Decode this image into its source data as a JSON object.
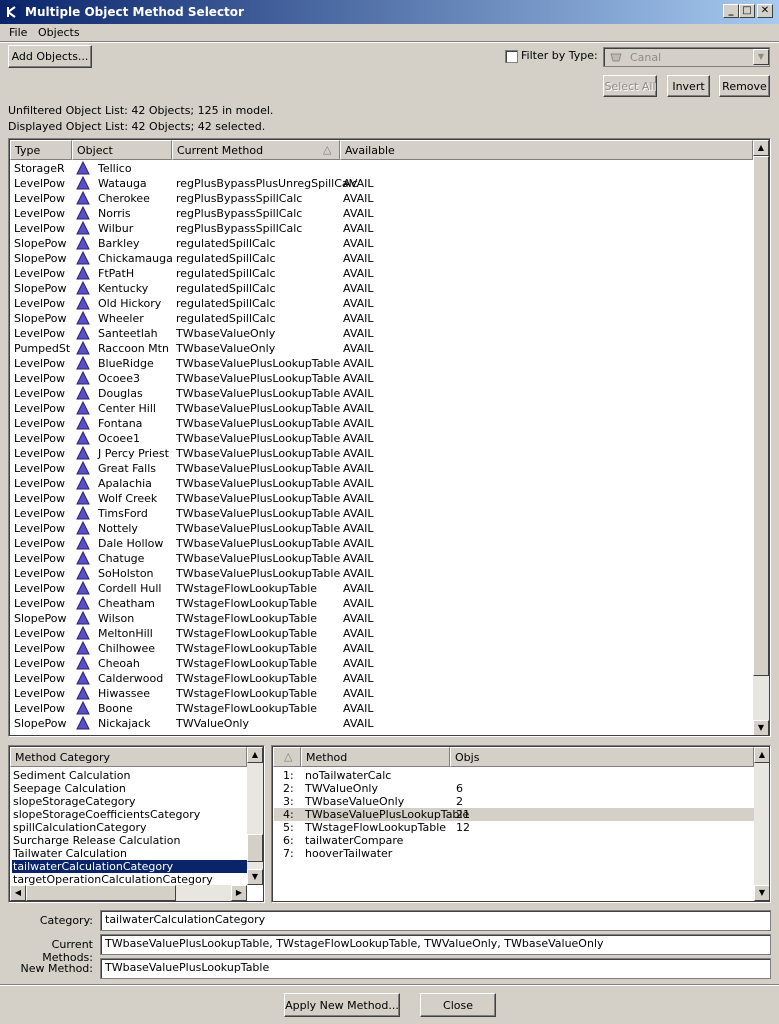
{
  "window": {
    "title": "Multiple Object Method Selector",
    "controls": {
      "minimize": "_",
      "maximize": "□",
      "close": "✕"
    }
  },
  "menu": [
    "File",
    "Objects"
  ],
  "toolbar": {
    "add_objects": "Add Objects...",
    "filter_label": "Filter by Type:",
    "filter_checked": false,
    "filter_value": "Canal",
    "filter_icon": "canal-icon",
    "select_all": "Select All",
    "invert": "Invert",
    "remove": "Remove"
  },
  "summary": {
    "unfiltered": "Unfiltered Object List:  42 Objects;  125 in model.",
    "displayed": "Displayed Object List:  42 Objects;  42 selected."
  },
  "object_table": {
    "columns": [
      "Type",
      "Object",
      "Current Method",
      "Available"
    ],
    "sort_indicator": "△",
    "rows": [
      {
        "type": "StorageR",
        "object": "Tellico",
        "method": "",
        "available": ""
      },
      {
        "type": "LevelPow",
        "object": "Watauga",
        "method": "regPlusBypassPlusUnregSpillCalc",
        "available": "AVAIL"
      },
      {
        "type": "LevelPow",
        "object": "Cherokee",
        "method": "regPlusBypassSpillCalc",
        "available": "AVAIL"
      },
      {
        "type": "LevelPow",
        "object": "Norris",
        "method": "regPlusBypassSpillCalc",
        "available": "AVAIL"
      },
      {
        "type": "LevelPow",
        "object": "Wilbur",
        "method": "regPlusBypassSpillCalc",
        "available": "AVAIL"
      },
      {
        "type": "SlopePow",
        "object": "Barkley",
        "method": "regulatedSpillCalc",
        "available": "AVAIL"
      },
      {
        "type": "SlopePow",
        "object": "Chickamauga",
        "method": "regulatedSpillCalc",
        "available": "AVAIL"
      },
      {
        "type": "LevelPow",
        "object": "FtPatH",
        "method": "regulatedSpillCalc",
        "available": "AVAIL"
      },
      {
        "type": "SlopePow",
        "object": "Kentucky",
        "method": "regulatedSpillCalc",
        "available": "AVAIL"
      },
      {
        "type": "LevelPow",
        "object": "Old Hickory",
        "method": "regulatedSpillCalc",
        "available": "AVAIL"
      },
      {
        "type": "SlopePow",
        "object": "Wheeler",
        "method": "regulatedSpillCalc",
        "available": "AVAIL"
      },
      {
        "type": "LevelPow",
        "object": "Santeetlah",
        "method": "TWbaseValueOnly",
        "available": "AVAIL"
      },
      {
        "type": "PumpedSt",
        "object": "Raccoon Mtn",
        "method": "TWbaseValueOnly",
        "available": "AVAIL"
      },
      {
        "type": "LevelPow",
        "object": "BlueRidge",
        "method": "TWbaseValuePlusLookupTable",
        "available": "AVAIL"
      },
      {
        "type": "LevelPow",
        "object": "Ocoee3",
        "method": "TWbaseValuePlusLookupTable",
        "available": "AVAIL"
      },
      {
        "type": "LevelPow",
        "object": "Douglas",
        "method": "TWbaseValuePlusLookupTable",
        "available": "AVAIL"
      },
      {
        "type": "LevelPow",
        "object": "Center Hill",
        "method": "TWbaseValuePlusLookupTable",
        "available": "AVAIL"
      },
      {
        "type": "LevelPow",
        "object": "Fontana",
        "method": "TWbaseValuePlusLookupTable",
        "available": "AVAIL"
      },
      {
        "type": "LevelPow",
        "object": "Ocoee1",
        "method": "TWbaseValuePlusLookupTable",
        "available": "AVAIL"
      },
      {
        "type": "LevelPow",
        "object": "J Percy Priest",
        "method": "TWbaseValuePlusLookupTable",
        "available": "AVAIL"
      },
      {
        "type": "LevelPow",
        "object": "Great Falls",
        "method": "TWbaseValuePlusLookupTable",
        "available": "AVAIL"
      },
      {
        "type": "LevelPow",
        "object": "Apalachia",
        "method": "TWbaseValuePlusLookupTable",
        "available": "AVAIL"
      },
      {
        "type": "LevelPow",
        "object": "Wolf Creek",
        "method": "TWbaseValuePlusLookupTable",
        "available": "AVAIL"
      },
      {
        "type": "LevelPow",
        "object": "TimsFord",
        "method": "TWbaseValuePlusLookupTable",
        "available": "AVAIL"
      },
      {
        "type": "LevelPow",
        "object": "Nottely",
        "method": "TWbaseValuePlusLookupTable",
        "available": "AVAIL"
      },
      {
        "type": "LevelPow",
        "object": "Dale Hollow",
        "method": "TWbaseValuePlusLookupTable",
        "available": "AVAIL"
      },
      {
        "type": "LevelPow",
        "object": "Chatuge",
        "method": "TWbaseValuePlusLookupTable",
        "available": "AVAIL"
      },
      {
        "type": "LevelPow",
        "object": "SoHolston",
        "method": "TWbaseValuePlusLookupTable",
        "available": "AVAIL"
      },
      {
        "type": "LevelPow",
        "object": "Cordell Hull",
        "method": "TWstageFlowLookupTable",
        "available": "AVAIL"
      },
      {
        "type": "LevelPow",
        "object": "Cheatham",
        "method": "TWstageFlowLookupTable",
        "available": "AVAIL"
      },
      {
        "type": "SlopePow",
        "object": "Wilson",
        "method": "TWstageFlowLookupTable",
        "available": "AVAIL"
      },
      {
        "type": "LevelPow",
        "object": "MeltonHill",
        "method": "TWstageFlowLookupTable",
        "available": "AVAIL"
      },
      {
        "type": "LevelPow",
        "object": "Chilhowee",
        "method": "TWstageFlowLookupTable",
        "available": "AVAIL"
      },
      {
        "type": "LevelPow",
        "object": "Cheoah",
        "method": "TWstageFlowLookupTable",
        "available": "AVAIL"
      },
      {
        "type": "LevelPow",
        "object": "Calderwood",
        "method": "TWstageFlowLookupTable",
        "available": "AVAIL"
      },
      {
        "type": "LevelPow",
        "object": "Hiwassee",
        "method": "TWstageFlowLookupTable",
        "available": "AVAIL"
      },
      {
        "type": "LevelPow",
        "object": "Boone",
        "method": "TWstageFlowLookupTable",
        "available": "AVAIL"
      },
      {
        "type": "SlopePow",
        "object": "Nickajack",
        "method": "TWValueOnly",
        "available": "AVAIL"
      }
    ]
  },
  "category_list": {
    "header": "Method Category",
    "items": [
      "Sediment Calculation",
      "Seepage Calculation",
      "slopeStorageCategory",
      "slopeStorageCoefficientsCategory",
      "spillCalculationCategory",
      "Surcharge Release Calculation",
      "Tailwater Calculation",
      "tailwaterCalculationCategory",
      "targetOperationCalculationCategory"
    ],
    "selected_index": 7
  },
  "method_table": {
    "columns": [
      "Method",
      "Objs"
    ],
    "sort_indicator": "△",
    "rows": [
      {
        "num": "1:",
        "method": "noTailwaterCalc",
        "objs": ""
      },
      {
        "num": "2:",
        "method": "TWValueOnly",
        "objs": "6"
      },
      {
        "num": "3:",
        "method": "TWbaseValueOnly",
        "objs": "2"
      },
      {
        "num": "4:",
        "method": "TWbaseValuePlusLookupTable",
        "objs": "21"
      },
      {
        "num": "5:",
        "method": "TWstageFlowLookupTable",
        "objs": "12"
      },
      {
        "num": "6:",
        "method": "tailwaterCompare",
        "objs": ""
      },
      {
        "num": "7:",
        "method": "hooverTailwater",
        "objs": ""
      }
    ],
    "selected_index": 3
  },
  "fields": {
    "category_label": "Category:",
    "category_value": "tailwaterCalculationCategory",
    "current_label": "Current Methods:",
    "current_value": "TWbaseValuePlusLookupTable, TWstageFlowLookupTable, TWValueOnly, TWbaseValueOnly",
    "new_label": "New Method:",
    "new_value": "TWbaseValuePlusLookupTable"
  },
  "bottom": {
    "apply": "Apply New Method...",
    "close": "Close"
  },
  "colors": {
    "titlebar_start": "#0a246a",
    "titlebar_end": "#a6caf0",
    "object_icon": "#5b4fc8",
    "selection": "#0a246a"
  }
}
